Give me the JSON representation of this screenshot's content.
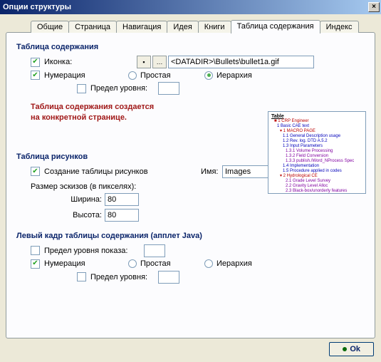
{
  "window": {
    "title": "Опции структуры",
    "close_glyph": "×"
  },
  "tabs": [
    {
      "label": "Общие"
    },
    {
      "label": "Страница"
    },
    {
      "label": "Навигация"
    },
    {
      "label": "Идея"
    },
    {
      "label": "Книги"
    },
    {
      "label": "Таблица содержания",
      "active": true
    },
    {
      "label": "Индекс"
    }
  ],
  "toc": {
    "title": "Таблица содержания",
    "icon_label": "Иконка:",
    "icon_checked": true,
    "icon_path": "<DATADIR>\\Bullets\\bullet1a.gif",
    "browse_glyph": "…",
    "numbering_label": "Нумерация",
    "numbering_checked": true,
    "simple_label": "Простая",
    "hier_label": "Иерархия",
    "simple_selected": false,
    "hier_selected": true,
    "levellimit_label": "Предел уровня:",
    "levellimit_checked": false,
    "levellimit_value": "",
    "note_line1": "Таблица содержания создается",
    "note_line2": "на конкретной странице."
  },
  "figs": {
    "title": "Таблица рисунков",
    "create_label": "Создание таблицы рисунков",
    "create_checked": true,
    "name_label": "Имя:",
    "name_value": "Images",
    "size_label": "Размер эскизов (в пикселях):",
    "width_label": "Ширина:",
    "width_value": "80",
    "height_label": "Высота:",
    "height_value": "80"
  },
  "leftframe": {
    "title": "Левый кадр таблицы содержания (апплет Java)",
    "showlevel_label": "Предел уровня показа:",
    "showlevel_checked": false,
    "showlevel_value": "",
    "numbering_label": "Нумерация",
    "numbering_checked": true,
    "simple_label": "Простая",
    "hier_label": "Иерархия",
    "simple_selected": false,
    "hier_selected": false,
    "levellimit_label": "Предел уровня:",
    "levellimit_checked": false,
    "levellimit_value": ""
  },
  "buttons": {
    "ok": "Ok"
  },
  "preview": {
    "title": "Table"
  }
}
